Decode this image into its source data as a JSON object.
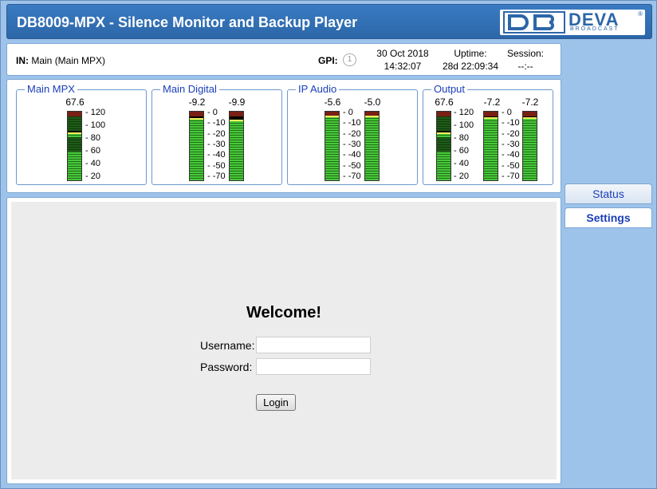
{
  "header": {
    "title": "DB8009-MPX - Silence Monitor and Backup Player",
    "logo_brand": "DEVA",
    "logo_sub": "BROADCAST",
    "logo_reg": "®"
  },
  "infobar": {
    "in_label": "IN:",
    "in_value": "Main (Main MPX)",
    "gpi_label": "GPI:",
    "gpi_indicator": "1",
    "date": "30 Oct 2018",
    "time": "14:32:07",
    "uptime_label": "Uptime:",
    "uptime_value": "28d 22:09:34",
    "session_label": "Session:",
    "session_value": "--:--"
  },
  "meters": {
    "main_mpx": {
      "title": "Main MPX",
      "value": "67.6",
      "scale": [
        "120",
        "100",
        "80",
        "60",
        "40",
        "20"
      ],
      "level": 0.67
    },
    "main_digital": {
      "title": "Main Digital",
      "left": "-9.2",
      "right": "-9.9",
      "scale": [
        "0",
        "-10",
        "-20",
        "-30",
        "-40",
        "-50",
        "-70"
      ],
      "level_left": 0.88,
      "level_right": 0.86
    },
    "ip_audio": {
      "title": "IP Audio",
      "left": "-5.6",
      "right": "-5.0",
      "scale": [
        "0",
        "-10",
        "-20",
        "-30",
        "-40",
        "-50",
        "-70"
      ],
      "level_left": 0.92,
      "level_right": 0.92
    },
    "output": {
      "title": "Output",
      "mpx": "67.6",
      "left": "-7.2",
      "right": "-7.2",
      "mpx_scale": [
        "120",
        "100",
        "80",
        "60",
        "40",
        "20"
      ],
      "scale": [
        "0",
        "-10",
        "-20",
        "-30",
        "-40",
        "-50",
        "-70"
      ],
      "level_mpx": 0.67,
      "level_left": 0.9,
      "level_right": 0.9
    }
  },
  "login": {
    "welcome": "Welcome!",
    "username_label": "Username:",
    "password_label": "Password:",
    "username_value": "",
    "password_value": "",
    "button": "Login"
  },
  "tabs": {
    "status": "Status",
    "settings": "Settings"
  }
}
